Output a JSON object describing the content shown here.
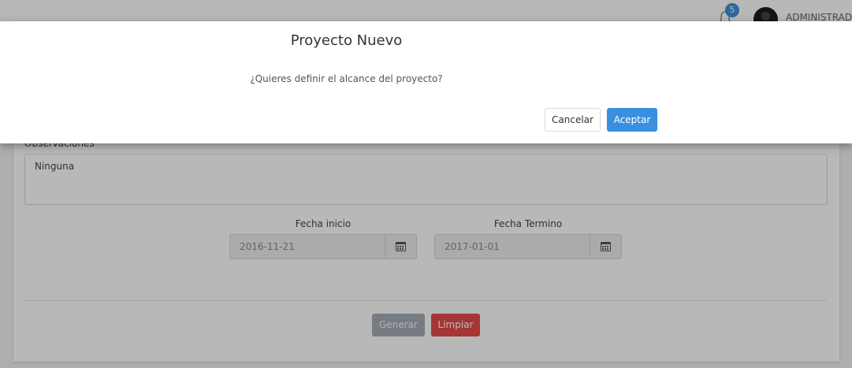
{
  "header": {
    "notification_count": "5",
    "user_name": "ADMINISTRADOR"
  },
  "form": {
    "observations_label": "Observaciones",
    "observations_value": "Ninguna",
    "start_date_label": "Fecha inicio",
    "start_date_value": "2016-11-21",
    "end_date_label": "Fecha Termino",
    "end_date_value": "2017-01-01",
    "generate_label": "Generar",
    "clear_label": "Limpiar"
  },
  "modal": {
    "title": "Proyecto Nuevo",
    "message": "¿Quieres definir el alcance del proyecto?",
    "cancel_label": "Cancelar",
    "accept_label": "Aceptar"
  },
  "icons": {
    "bell": "bell-icon",
    "calendar": "calendar-icon"
  },
  "colors": {
    "primary": "#3b8fe0",
    "danger": "#e74b4b",
    "badge": "#3f8fd9",
    "disabled": "#a5acb4"
  }
}
